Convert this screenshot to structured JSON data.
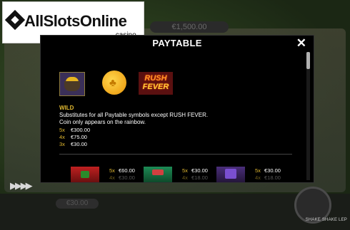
{
  "logo": {
    "name": "AllSlotsOnline",
    "tld": ".casino"
  },
  "background": {
    "balance": "€1,500.00",
    "credit": "€30.00",
    "footer_title": "SHAKE SHAKE LEP",
    "speed_icon": "fast-forward-icon"
  },
  "paytable": {
    "title": "PAYTABLE",
    "close_icon": "close-icon",
    "symbols_top": [
      "pot-of-gold-symbol",
      "gold-coin-symbol",
      "rush-fever-symbol"
    ],
    "rush_fever_text": [
      "RUSH",
      "FEVER"
    ],
    "wild": {
      "title": "WILD",
      "description": [
        "Substitutes for all Paytable symbols except RUSH FEVER.",
        "Coin only appears on the rainbow."
      ],
      "pays": [
        {
          "mult": "5x",
          "value": "€300.00"
        },
        {
          "mult": "4x",
          "value": "€75.00"
        },
        {
          "mult": "3x",
          "value": "€30.00"
        }
      ]
    },
    "symbols_row": [
      {
        "icon": "red-hat-symbol",
        "pays": [
          {
            "mult": "5x",
            "value": "€60.00"
          },
          {
            "mult": "4x",
            "value": "€30.00"
          }
        ]
      },
      {
        "icon": "green-hat-symbol",
        "pays": [
          {
            "mult": "5x",
            "value": "€30.00"
          },
          {
            "mult": "4x",
            "value": "€18.00"
          }
        ]
      },
      {
        "icon": "purple-hat-symbol",
        "pays": [
          {
            "mult": "5x",
            "value": "€30.00"
          },
          {
            "mult": "4x",
            "value": "€18.00"
          }
        ]
      }
    ]
  }
}
